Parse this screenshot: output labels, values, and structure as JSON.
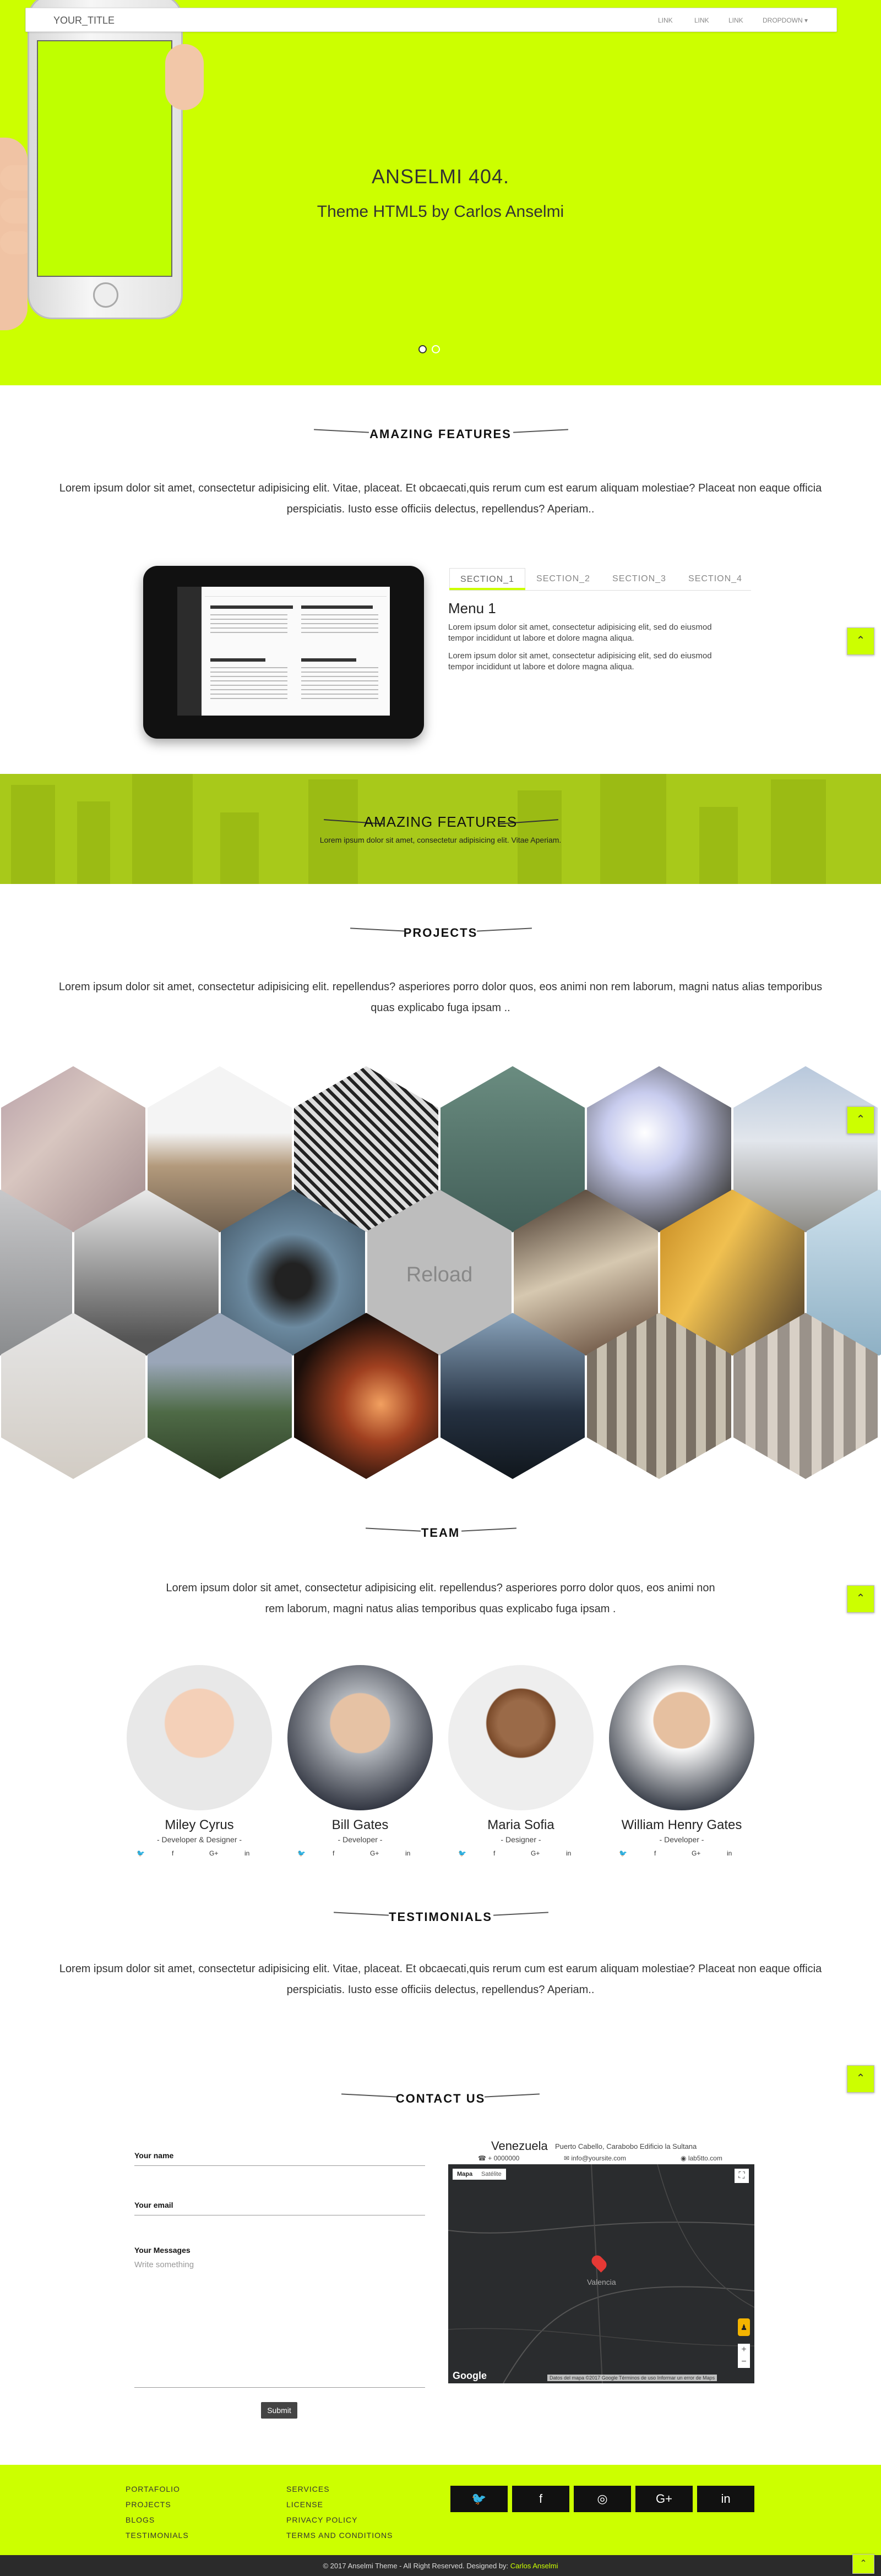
{
  "navbar": {
    "brand": "YOUR_TITLE",
    "links": [
      "LINK",
      "LINK",
      "LINK"
    ],
    "dropdown": "DROPDOWN ▾"
  },
  "hero": {
    "title": "ANSELMI 404.",
    "subtitle": "Theme HTML5 by Carlos Anselmi"
  },
  "features": {
    "title": "AMAZING FEATURES",
    "text_line1": "Lorem ipsum dolor sit amet, consectetur adipisicing elit. Vitae, placeat. Et obcaecati,quis rerum cum est earum aliquam molestiae? Placeat non eaque officia",
    "text_line2": "perspiciatis. Iusto esse officiis delectus, repellendus? Aperiam..",
    "tabs": [
      "SECTION_1",
      "SECTION_2",
      "SECTION_3",
      "SECTION_4"
    ],
    "menu_title": "Menu 1",
    "menu_text": "Lorem ipsum dolor sit amet, consectetur adipisicing elit, sed do eiusmod tempor incididunt ut labore et dolore magna aliqua."
  },
  "band": {
    "title": "AMAZING FEATURES",
    "subtitle": "Lorem ipsum dolor sit amet, consectetur adipisicing elit. Vitae Aperiam."
  },
  "projects": {
    "title": "PROJECTS",
    "text_line1": "Lorem ipsum dolor sit amet, consectetur adipisicing elit. repellendus? asperiores porro dolor quos, eos animi non rem laborum, magni natus alias temporibus",
    "text_line2": "quas explicabo fuga ipsam ..",
    "reload": "Reload"
  },
  "team": {
    "title": "TEAM",
    "text_line1": "Lorem ipsum dolor sit amet, consectetur adipisicing elit. repellendus? asperiores porro dolor quos, eos animi non",
    "text_line2": "rem laborum, magni natus alias temporibus quas explicabo fuga ipsam .",
    "members": [
      {
        "name": "Miley Cyrus",
        "role": "- Developer & Designer -"
      },
      {
        "name": "Bill Gates",
        "role": "- Developer -"
      },
      {
        "name": "Maria Sofia",
        "role": "- Designer -"
      },
      {
        "name": "William Henry Gates",
        "role": "- Developer -"
      }
    ],
    "social": [
      "🐦",
      "f",
      "G+",
      "in"
    ]
  },
  "testimonials": {
    "title": "TESTIMONIALS",
    "text_line1": "Lorem ipsum dolor sit amet, consectetur adipisicing elit. Vitae, placeat. Et obcaecati,quis rerum cum est earum aliquam molestiae? Placeat non eaque officia",
    "text_line2": "perspiciatis. Iusto esse officiis delectus, repellendus? Aperiam.."
  },
  "contact": {
    "title": "CONTACT US",
    "name_label": "Your name",
    "email_label": "Your email",
    "msg_label": "Your Messages",
    "msg_placeholder": "Write something",
    "submit": "Submit",
    "city": "Venezuela",
    "address": "Puerto Cabello, Carabobo  Edificio la Sultana",
    "phone": "+ 0000000",
    "email": "info@yoursite.com",
    "site": "lab5tto.com",
    "map_tabs": [
      "Mapa",
      "Satélite"
    ],
    "map_city": "Valencia",
    "map_brand": "Google",
    "map_footer": "Datos del mapa ©2017 Google   Términos de uso   Informar un error de Maps"
  },
  "footer": {
    "col1": [
      "PORTAFOLIO",
      "PROJECTS",
      "BLOGS",
      "TESTIMONIALS"
    ],
    "col2": [
      "SERVICES",
      "LICENSE",
      "PRIVACY POLICY",
      "TERMS AND CONDITIONS"
    ],
    "social": [
      "🐦",
      "f",
      "◎",
      "G+",
      "in"
    ],
    "copyright": "© 2017 Anselmi Theme - All Right Reserved. Designed by:",
    "designer": "Carlos Anselmi"
  },
  "to_top": "⌃",
  "colors": {
    "accent": "#ccff00",
    "dark": "#111111"
  }
}
